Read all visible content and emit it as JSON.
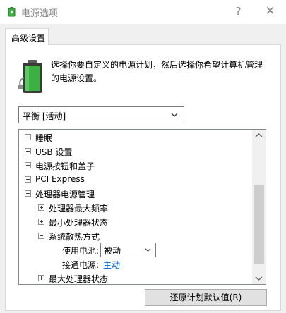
{
  "window": {
    "title": "电源选项",
    "help_glyph": "?",
    "close_glyph": "✕",
    "icon": "power-options-icon"
  },
  "tab": {
    "label": "高级设置"
  },
  "description": "选择你要自定义的电源计划，然后选择你希望计算机管理的电源设置。",
  "plan_select": {
    "value": "平衡 [活动]"
  },
  "tree": {
    "items": [
      {
        "label": "睡眠",
        "state": "collapsed"
      },
      {
        "label": "USB 设置",
        "state": "collapsed"
      },
      {
        "label": "电源按钮和盖子",
        "state": "collapsed"
      },
      {
        "label": "PCI Express",
        "state": "collapsed"
      },
      {
        "label": "处理器电源管理",
        "state": "expanded"
      },
      {
        "label": "处理器最大频率",
        "state": "collapsed"
      },
      {
        "label": "最小处理器状态",
        "state": "collapsed"
      },
      {
        "label": "系统散热方式",
        "state": "expanded"
      },
      {
        "label": "最大处理器状态",
        "state": "collapsed"
      }
    ],
    "battery_setting": {
      "label": "使用电池:",
      "value": "被动"
    },
    "plugged_setting": {
      "label": "接通电源:",
      "value": "主动"
    }
  },
  "colors": {
    "link": "#0066cc",
    "battery_green": "#3cb043"
  },
  "buttons": {
    "restore": "还原计划默认值(R)"
  }
}
